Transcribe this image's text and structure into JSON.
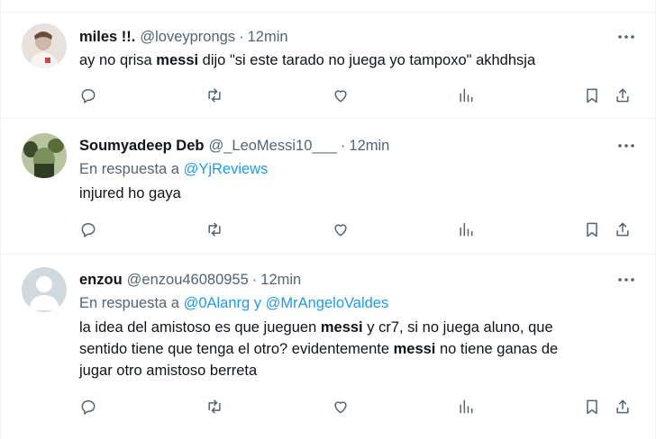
{
  "tweets": [
    {
      "name": "miles !!.",
      "handle": "@loveyprongs",
      "dot": "·",
      "time": "12min",
      "text_parts": [
        "ay no qrisa ",
        "messi",
        " dijo \"si este tarado no juega yo tampoxo\" akhdhsja"
      ],
      "avatar_colors": [
        "#cbb8a8",
        "#6d4a3a",
        "#e9e2dc"
      ]
    },
    {
      "name": "Soumyadeep Deb",
      "handle": "@_LeoMessi10___",
      "dot": "·",
      "time": "12min",
      "reply_prefix": "En respuesta a ",
      "reply_mentions": [
        "@YjReviews"
      ],
      "text_parts": [
        "injured ho gaya"
      ],
      "avatar_colors": [
        "#7a8f5a",
        "#3b4a2a",
        "#b8c4a0"
      ]
    },
    {
      "name": "enzou",
      "handle": "@enzou46080955",
      "dot": "·",
      "time": "12min",
      "reply_prefix": "En respuesta a ",
      "reply_mentions": [
        "@0Alanrg",
        "@MrAngeloValdes"
      ],
      "reply_joiner": " y ",
      "text_lines": [
        [
          "la idea del amistoso es que jueguen ",
          "messi",
          " y cr7, si no juega aluno, que"
        ],
        [
          "sentido tiene que tenga el otro? evidentemente ",
          "messi",
          " no tiene ganas de"
        ],
        [
          "jugar otro amistoso berreta"
        ]
      ],
      "avatar_colors": [
        "#cfd9de",
        "#aab8c2",
        "#e6ecf0"
      ]
    }
  ],
  "icons": {
    "more": "more-dots-icon",
    "reply": "reply-bubble-icon",
    "retweet": "retweet-icon",
    "like": "heart-icon",
    "views": "views-chart-icon",
    "bookmark": "bookmark-icon",
    "share": "share-icon"
  },
  "colors": {
    "link": "#1d9bf0",
    "secondary_text": "#536471",
    "primary_text": "#0f1419",
    "divider": "#eff3f4"
  }
}
